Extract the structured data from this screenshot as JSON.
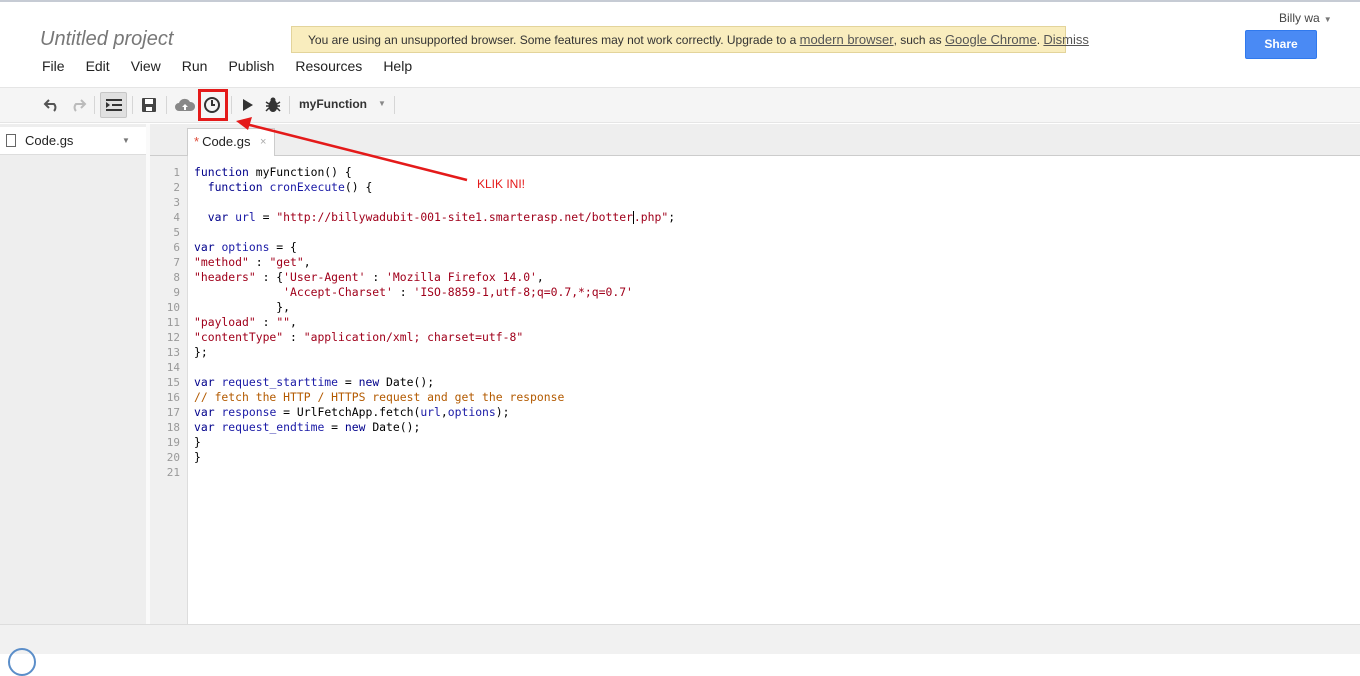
{
  "app": {
    "title": "Untitled project",
    "user": "Billy wa",
    "share_label": "Share"
  },
  "menu": [
    "File",
    "Edit",
    "View",
    "Run",
    "Publish",
    "Resources",
    "Help"
  ],
  "warning": {
    "text": "You are using an unsupported browser. Some features may not work correctly. Upgrade to a",
    "link1": "modern browser",
    "mid": ", such as",
    "link2": "Google Chrome",
    "end": ".",
    "dismiss": "Dismiss"
  },
  "toolbar": {
    "function_select": "myFunction",
    "icons": [
      "undo-icon",
      "redo-icon",
      "indent-icon",
      "save-icon",
      "cloud-upload-icon",
      "clock-trigger-icon",
      "run-icon",
      "debug-icon"
    ]
  },
  "sidebar": {
    "file": "Code.gs"
  },
  "tab": {
    "label": "Code.gs",
    "modified_marker": "*",
    "close": "×"
  },
  "annotation": {
    "label": "KLIK INI!"
  },
  "colors": {
    "share_button": "#4a8af4",
    "warning_bg": "#f9edbe",
    "annotation_red": "#e41a1a"
  },
  "code": {
    "line_numbers": [
      "1",
      "2",
      "3",
      "4",
      "5",
      "6",
      "7",
      "8",
      "9",
      "10",
      "11",
      "12",
      "13",
      "14",
      "15",
      "16",
      "17",
      "18",
      "19",
      "20",
      "21"
    ],
    "lines": [
      "function myFunction() {",
      "  function cronExecute() {",
      "",
      "  var url = \"http://billywadubit-001-site1.smarterasp.net/botter.php\";",
      "",
      "var options = {",
      "\"method\" : \"get\",",
      "\"headers\" : {'User-Agent' : 'Mozilla Firefox 14.0',",
      "             'Accept-Charset' : 'ISO-8859-1,utf-8;q=0.7,*;q=0.7'",
      "            },",
      "\"payload\" : \"\",",
      "\"contentType\" : \"application/xml; charset=utf-8\"",
      "};",
      "",
      "var request_starttime = new Date();",
      "// fetch the HTTP / HTTPS request and get the response",
      "var response = UrlFetchApp.fetch(url,options);",
      "var request_endtime = new Date();",
      "}",
      "}",
      ""
    ]
  }
}
